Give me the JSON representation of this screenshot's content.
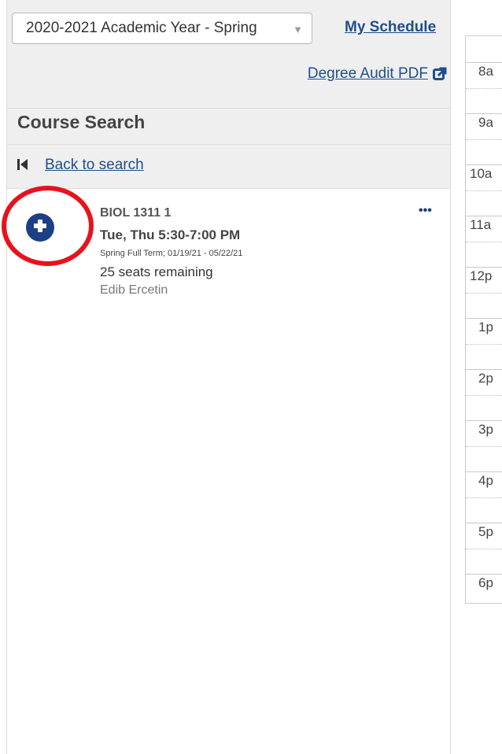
{
  "header": {
    "term_select_value": "2020-2021 Academic Year - Spring",
    "my_schedule_link": "My Schedule",
    "degree_audit_link": "Degree Audit PDF"
  },
  "search": {
    "title": "Course Search",
    "back_link": "Back to search"
  },
  "course": {
    "code": "BIOL 1311 1",
    "time": "Tue, Thu 5:30-7:00 PM",
    "term": "Spring Full Term; 01/19/21 - 05/22/21",
    "seats": "25 seats remaining",
    "instructor": "Edib Ercetin",
    "more_label": "•••"
  },
  "calendar": {
    "hours": [
      "8a",
      "9a",
      "10a",
      "11a",
      "12p",
      "1p",
      "2p",
      "3p",
      "4p",
      "5p",
      "6p"
    ]
  },
  "colors": {
    "accent": "#1f4e8c",
    "add_button": "#1c3f86",
    "highlight": "#e8121c"
  },
  "icons": {
    "dropdown": "caret-down",
    "external": "external-link",
    "back": "skip-back",
    "add": "plus-circle"
  }
}
